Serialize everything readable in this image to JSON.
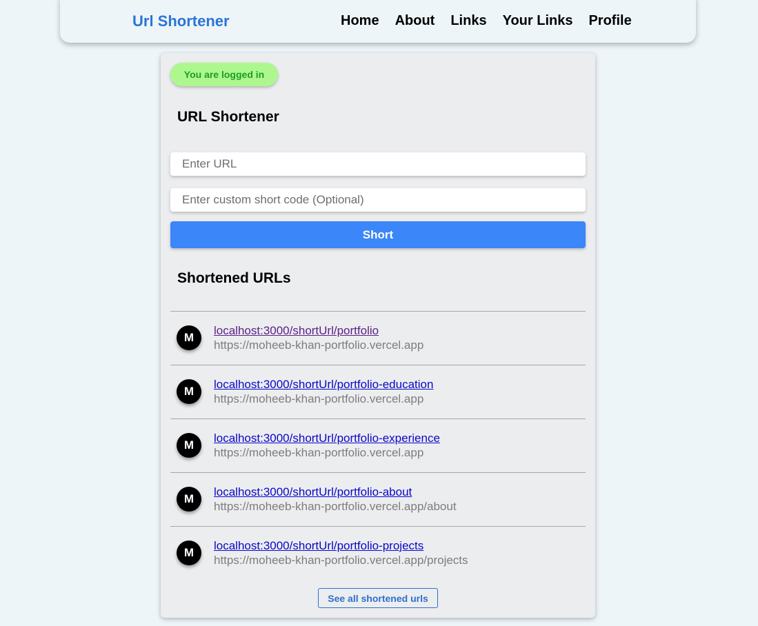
{
  "navbar": {
    "brand": "Url Shortener",
    "links": [
      "Home",
      "About",
      "Links",
      "Your Links",
      "Profile"
    ]
  },
  "status_badge": "You are logged in",
  "shortener": {
    "title": "URL Shortener",
    "url_placeholder": "Enter URL",
    "code_placeholder": "Enter custom short code (Optional)",
    "button_label": "Short"
  },
  "shortened": {
    "title": "Shortened URLs",
    "items": [
      {
        "avatar": "M",
        "short_url": "localhost:3000/shortUrl/portfolio",
        "original_url": "https://moheeb-khan-portfolio.vercel.app"
      },
      {
        "avatar": "M",
        "short_url": "localhost:3000/shortUrl/portfolio-education",
        "original_url": "https://moheeb-khan-portfolio.vercel.app"
      },
      {
        "avatar": "M",
        "short_url": "localhost:3000/shortUrl/portfolio-experience",
        "original_url": "https://moheeb-khan-portfolio.vercel.app"
      },
      {
        "avatar": "M",
        "short_url": "localhost:3000/shortUrl/portfolio-about",
        "original_url": "https://moheeb-khan-portfolio.vercel.app/about"
      },
      {
        "avatar": "M",
        "short_url": "localhost:3000/shortUrl/portfolio-projects",
        "original_url": "https://moheeb-khan-portfolio.vercel.app/projects"
      }
    ],
    "see_all_label": "See all shortened urls"
  },
  "colors": {
    "brand": "#2c74d6",
    "primary_button": "#3b86f9",
    "badge_bg": "#adf78f",
    "badge_text": "#1e9d1e",
    "link": "#0a06c9",
    "visited_link": "#5b1f86"
  }
}
